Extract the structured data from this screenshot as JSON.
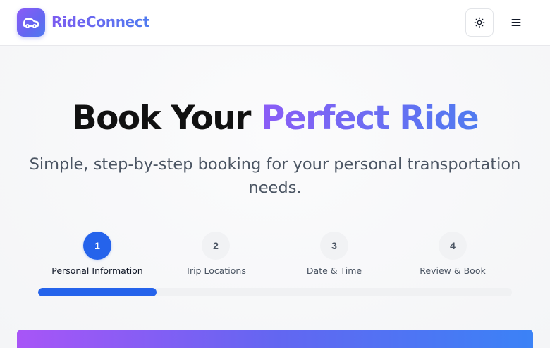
{
  "header": {
    "brand": "RideConnect",
    "logo_icon": "car-icon",
    "theme_icon": "sun-icon",
    "menu_icon": "hamburger-menu-icon"
  },
  "hero": {
    "title_plain": "Book Your ",
    "title_accent": "Perfect Ride",
    "subtitle": "Simple, step-by-step booking for your personal transportation needs."
  },
  "stepper": {
    "steps": [
      {
        "number": "1",
        "label": "Personal Information",
        "active": true
      },
      {
        "number": "2",
        "label": "Trip Locations",
        "active": false
      },
      {
        "number": "3",
        "label": "Date & Time",
        "active": false
      },
      {
        "number": "4",
        "label": "Review & Book",
        "active": false
      }
    ],
    "progress_fraction": 0.25
  },
  "colors": {
    "primary": "#2563eb",
    "accent_start": "#8b5cf6",
    "accent_end": "#4f7bf0"
  }
}
